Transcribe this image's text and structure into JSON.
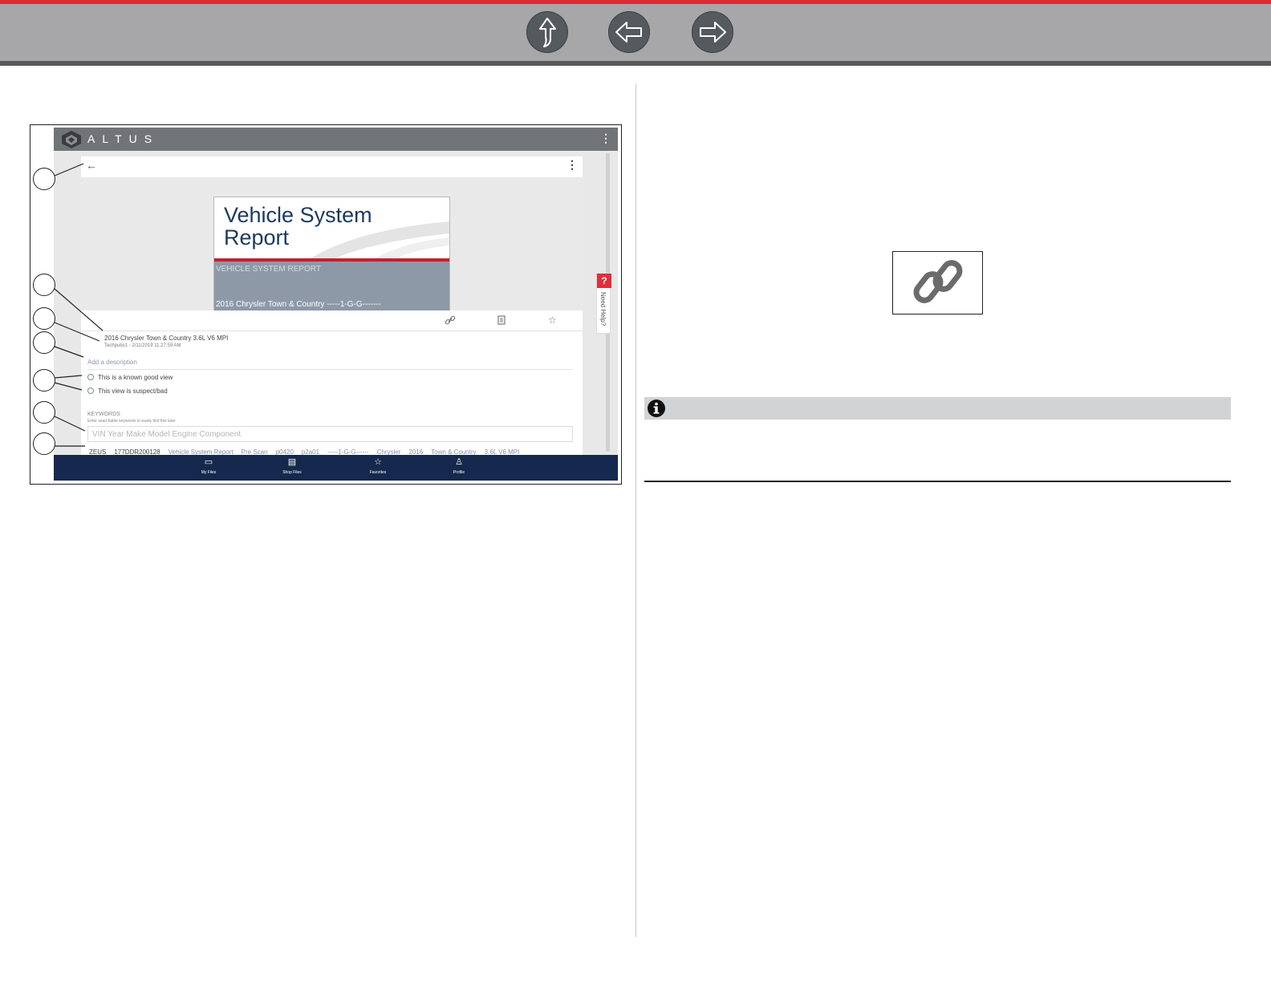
{
  "nav": {
    "up_icon": "up-arrow-icon",
    "back_icon": "back-arrow-icon",
    "forward_icon": "forward-arrow-icon",
    "accent_color": "#dc2b35"
  },
  "figure": {
    "app_name": "ALTUS",
    "report": {
      "title": "Vehicle System Report",
      "subtitle": "VEHICLE SYSTEM REPORT",
      "vehicle_line": "2016  Chrysler  Town & Country  -----1-G-G-------"
    },
    "entry": {
      "title": "2016 Chrysler Town & Country 3.6L V6 MPI",
      "meta": "Techpubs1 - 2/11/2019 11:27:59 AM",
      "add_description": "Add a description"
    },
    "radio_options": [
      "This is a known good view",
      "This view is suspect/bad"
    ],
    "keywords": {
      "label": "KEYWORDS",
      "hint": "Enter searchable keywords to easily find this later",
      "placeholder": "VIN Year Make Model Engine Component"
    },
    "tags": [
      "ZEUS",
      "177DDR200128",
      "Vehicle System Report",
      "Pre Scan",
      "p0420",
      "p2a01",
      "-----1-G-G------",
      "Chrysler",
      "2016",
      "Town & Country",
      "3.6L V6 MPI"
    ],
    "help": {
      "symbol": "?",
      "label": "Need Help?"
    },
    "bottom_nav": [
      "My Files",
      "Shop Files",
      "Favorites",
      "Profile"
    ]
  },
  "right": {
    "link_icon": "link-icon",
    "note_icon": "info-icon"
  }
}
